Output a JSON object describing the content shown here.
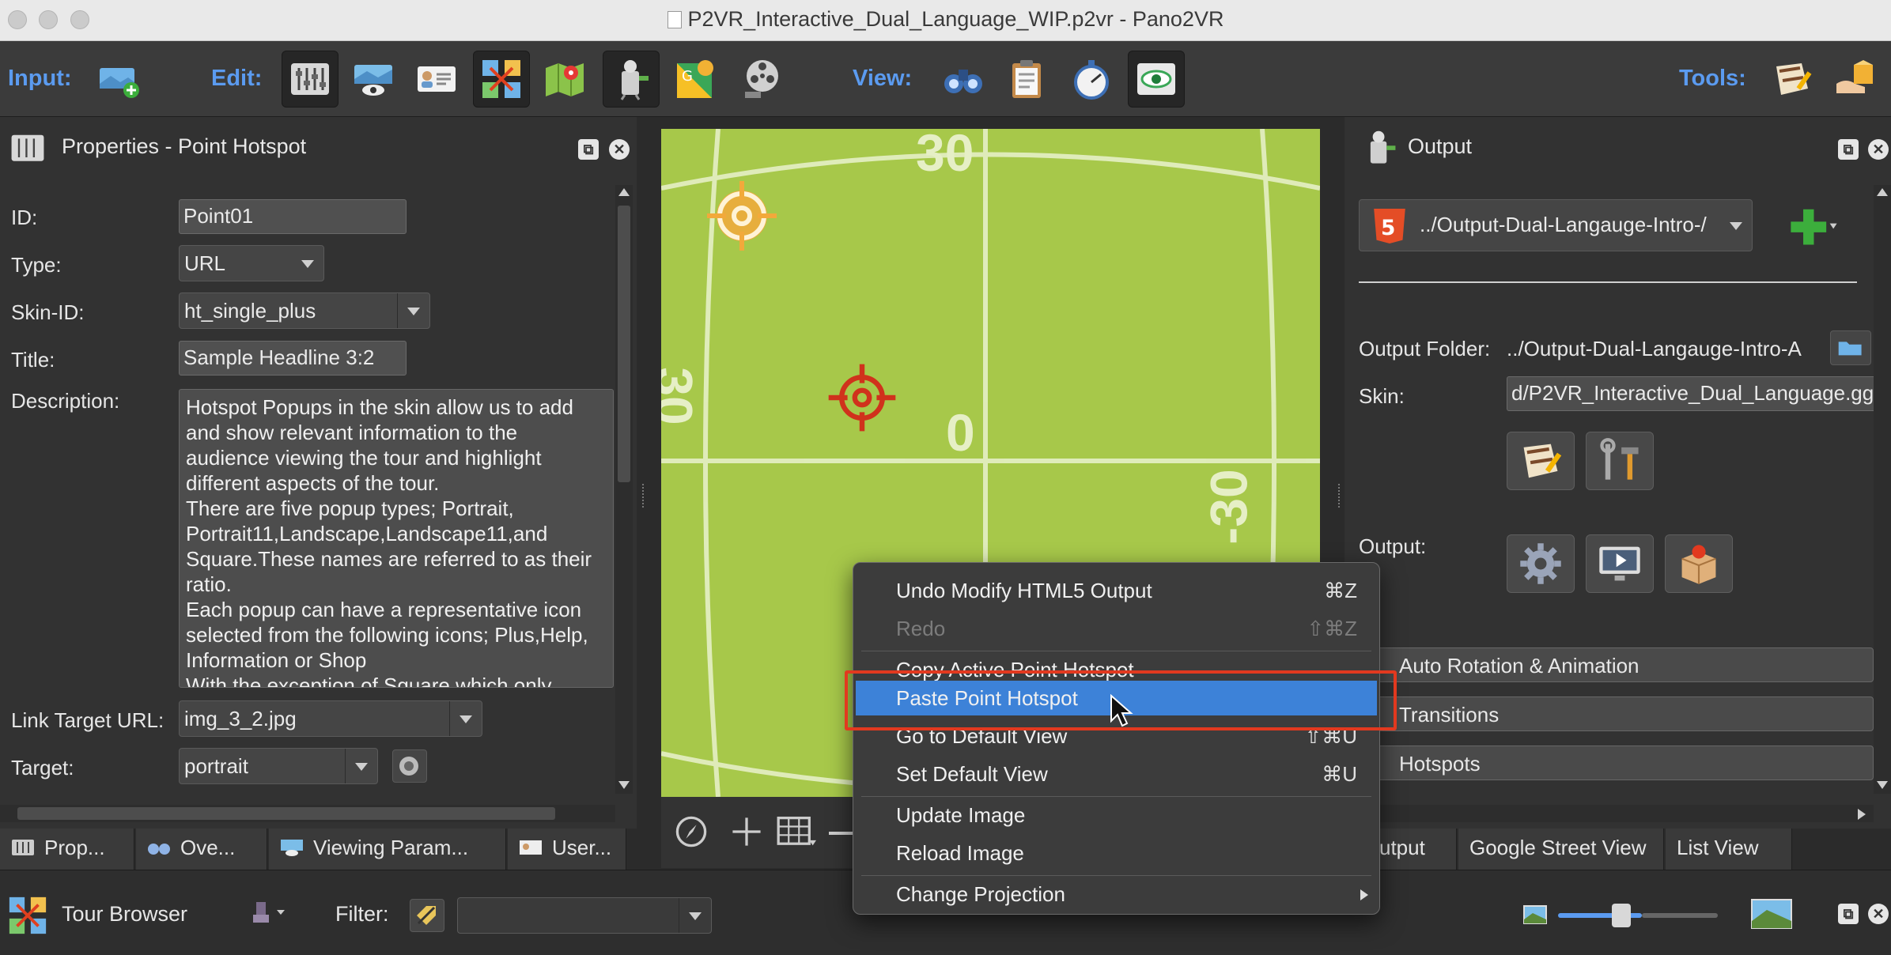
{
  "window": {
    "title": "P2VR_Interactive_Dual_Language_WIP.p2vr - Pano2VR"
  },
  "toolbar": {
    "input_label": "Input:",
    "edit_label": "Edit:",
    "view_label": "View:",
    "tools_label": "Tools:"
  },
  "properties": {
    "title": "Properties - Point Hotspot",
    "id_label": "ID:",
    "id_value": "Point01",
    "type_label": "Type:",
    "type_value": "URL",
    "skin_label": "Skin-ID:",
    "skin_value": "ht_single_plus",
    "title_label": "Title:",
    "title_value": "Sample Headline 3:2",
    "desc_label": "Description:",
    "desc_value": "Hotspot Popups in the skin allow us to add\nand show relevant information to the\naudience viewing the tour and highlight\ndifferent aspects of the tour.\nThere are five popup types; Portrait,\nPortrait11,Landscape,Landscape11,and\nSquare.These names are referred to as their\nratio.\nEach popup can have a representative icon\nselected from the following icons; Plus,Help,\nInformation or Shop\nWith the exception of Square which only",
    "link_label": "Link Target URL:",
    "link_value": "img_3_2.jpg",
    "target_label": "Target:",
    "target_value": "portrait"
  },
  "viewer": {
    "grid_labels": {
      "top": "30",
      "left": "30",
      "center": "0",
      "right": "-30"
    }
  },
  "output": {
    "title": "Output",
    "format_value": "../Output-Dual-Langauge-Intro-/",
    "folder_label": "Output Folder:",
    "folder_value": "../Output-Dual-Langauge-Intro-A",
    "skin_label": "Skin:",
    "skin_value": "d/P2VR_Interactive_Dual_Language.gg",
    "output_label": "Output:",
    "sections": [
      "Auto Rotation & Animation",
      "Transitions",
      "Hotspots"
    ]
  },
  "tabs": {
    "left": [
      "Prop...",
      "Ove...",
      "Viewing Param...",
      "User..."
    ],
    "right": [
      "utput",
      "Google Street View",
      "List View"
    ]
  },
  "tour_browser": {
    "title": "Tour Browser",
    "filter_label": "Filter:"
  },
  "context_menu": {
    "items": [
      {
        "label": "Undo Modify HTML5 Output",
        "shortcut": "⌘Z"
      },
      {
        "label": "Redo",
        "shortcut": "⇧⌘Z"
      },
      {
        "label": "Copy Active Point Hotspot",
        "shortcut": ""
      },
      {
        "label": "Paste Point Hotspot",
        "shortcut": ""
      },
      {
        "label": "Go to Default View",
        "shortcut": "⇧⌘U"
      },
      {
        "label": "Set Default View",
        "shortcut": "⌘U"
      },
      {
        "label": "Update Image",
        "shortcut": ""
      },
      {
        "label": "Reload Image",
        "shortcut": ""
      },
      {
        "label": "Change Projection",
        "shortcut": ""
      }
    ]
  },
  "colors": {
    "accent_blue": "#5b9bf0",
    "menu_selected": "#3d82d8",
    "highlight_red": "#e2391f",
    "viewer_green": "#a7c84a",
    "hotspot_red": "#d0321c",
    "hotspot_orange": "#f2a93b"
  }
}
